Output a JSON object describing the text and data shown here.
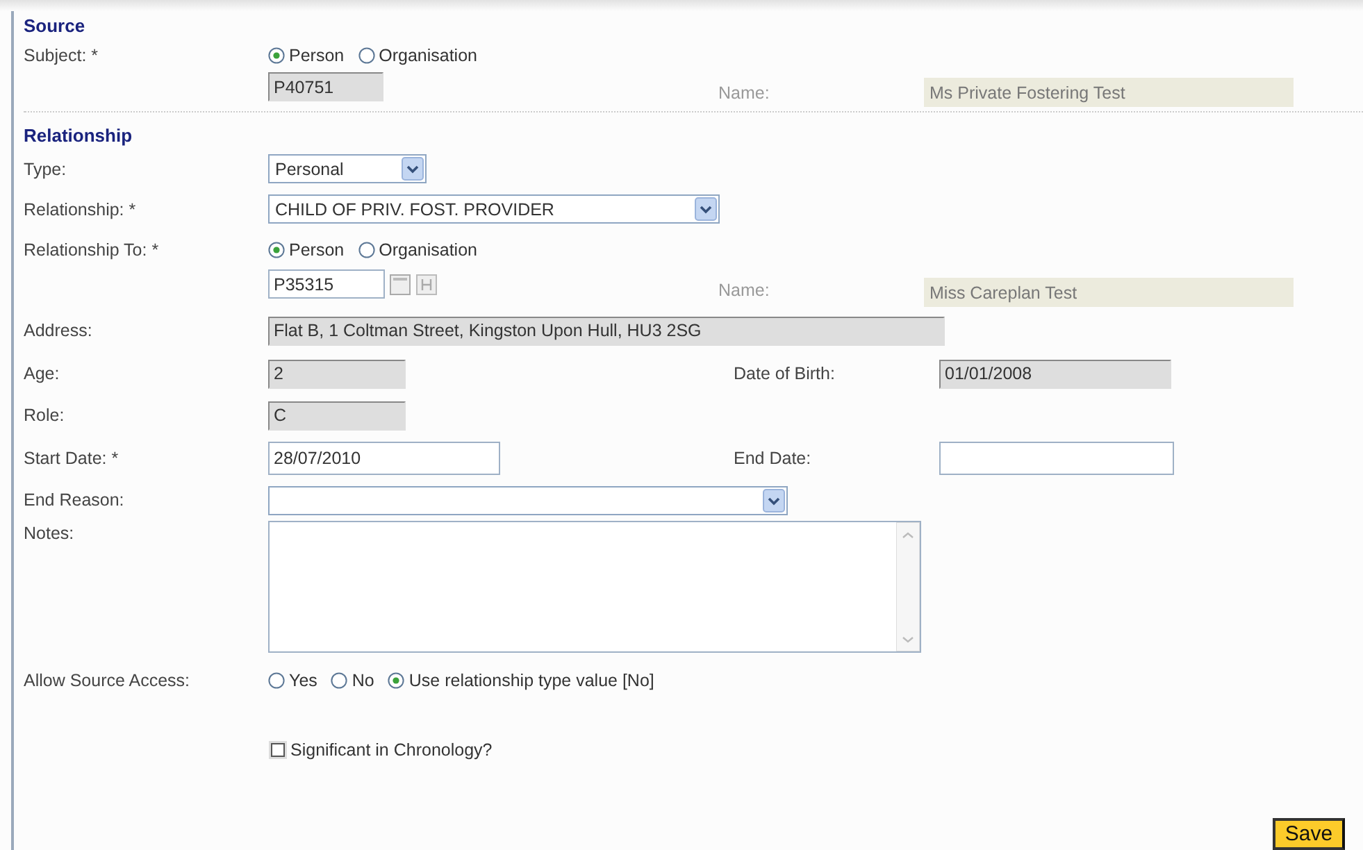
{
  "source": {
    "heading": "Source",
    "subject": {
      "label": "Subject: *",
      "options": [
        {
          "label": "Person",
          "selected": true
        },
        {
          "label": "Organisation",
          "selected": false
        }
      ],
      "id_value": "P40751",
      "name_label": "Name:",
      "name_value": "Ms Private Fostering Test"
    }
  },
  "relationship": {
    "heading": "Relationship",
    "type": {
      "label": "Type:",
      "value": "Personal"
    },
    "relationship": {
      "label": "Relationship: *",
      "value": "CHILD OF PRIV. FOST. PROVIDER"
    },
    "relationship_to": {
      "label": "Relationship To: *",
      "options": [
        {
          "label": "Person",
          "selected": true
        },
        {
          "label": "Organisation",
          "selected": false
        }
      ],
      "id_value": "P35315",
      "name_label": "Name:",
      "name_value": "Miss Careplan Test"
    },
    "address": {
      "label": "Address:",
      "value": "Flat B, 1 Coltman Street, Kingston Upon Hull, HU3 2SG"
    },
    "age": {
      "label": "Age:",
      "value": "2"
    },
    "date_of_birth": {
      "label": "Date of Birth:",
      "value": "01/01/2008"
    },
    "role": {
      "label": "Role:",
      "value": "C"
    },
    "start_date": {
      "label": "Start Date: *",
      "value": "28/07/2010"
    },
    "end_date": {
      "label": "End Date:"
    },
    "end_reason": {
      "label": "End Reason:"
    },
    "notes": {
      "label": "Notes:"
    },
    "allow_source_access": {
      "label": "Allow Source Access:",
      "options": [
        {
          "label": "Yes",
          "selected": false
        },
        {
          "label": "No",
          "selected": false
        },
        {
          "label": "Use relationship type value [No]",
          "selected": true
        }
      ]
    },
    "significant_in_chronology": {
      "label": "Significant in Chronology?",
      "checked": false
    }
  },
  "save_button": "Save"
}
